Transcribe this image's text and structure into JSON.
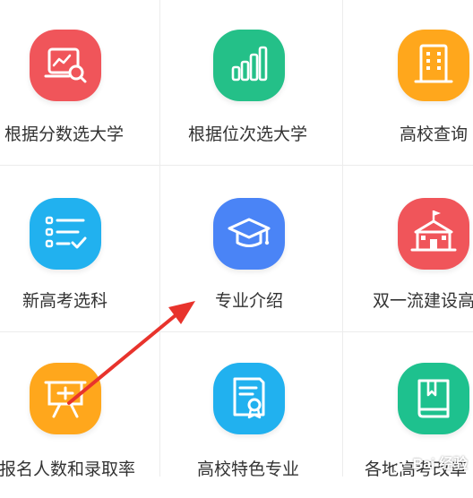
{
  "colors": {
    "red": "#f0555a",
    "green": "#24c088",
    "orange": "#ffa71c",
    "cyan": "#21b1ef",
    "blue": "#4a84f6",
    "teal": "#1ec18e",
    "annotation_arrow": "#e8332c"
  },
  "grid": {
    "tiles": [
      {
        "label": "根据分数选大学",
        "icon": "score-chart-magnifier-icon",
        "color": "red"
      },
      {
        "label": "根据位次选大学",
        "icon": "bar-chart-icon",
        "color": "green"
      },
      {
        "label": "高校查询",
        "icon": "building-icon",
        "color": "orange"
      },
      {
        "label": "新高考选科",
        "icon": "checklist-icon",
        "color": "cyan"
      },
      {
        "label": "专业介绍",
        "icon": "graduation-cap-icon",
        "color": "blue"
      },
      {
        "label": "双一流建设高",
        "icon": "school-building-icon",
        "color": "red"
      },
      {
        "label": "报名人数和录取率",
        "icon": "presentation-board-icon",
        "color": "orange"
      },
      {
        "label": "高校特色专业",
        "icon": "certificate-document-icon",
        "color": "cyan"
      },
      {
        "label": "各地高考改革",
        "icon": "book-icon",
        "color": "teal"
      }
    ]
  },
  "watermark": {
    "text": "Bai 经验"
  }
}
